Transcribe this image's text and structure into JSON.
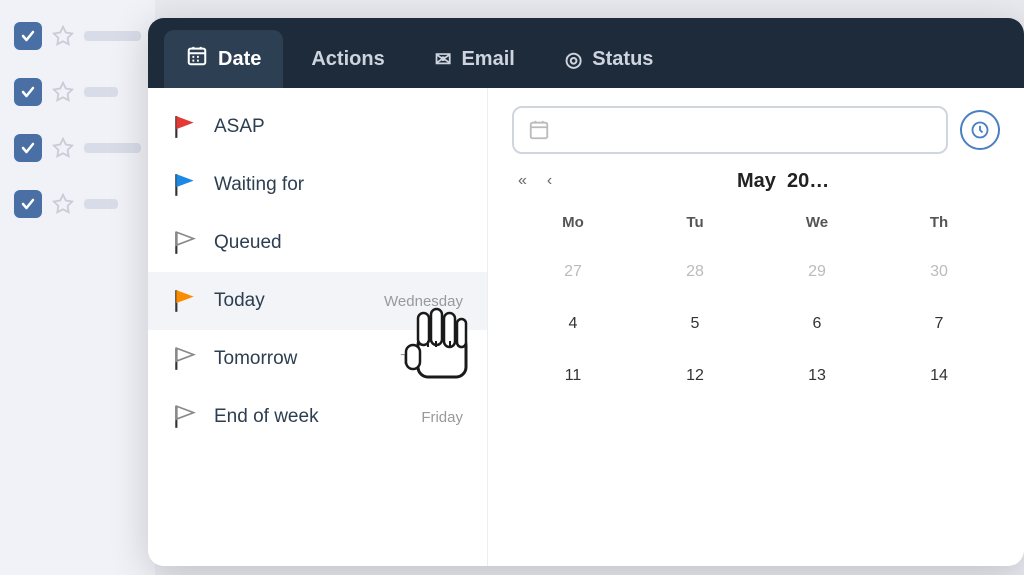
{
  "tabs": [
    {
      "id": "date",
      "label": "Date",
      "icon": "⊞",
      "active": true
    },
    {
      "id": "actions",
      "label": "Actions",
      "icon": "",
      "active": false
    },
    {
      "id": "email",
      "label": "Email",
      "icon": "✉",
      "active": false
    },
    {
      "id": "status",
      "label": "Status",
      "icon": "◎",
      "active": false
    }
  ],
  "menu_items": [
    {
      "id": "asap",
      "label": "ASAP",
      "day": "",
      "flag_color": "red"
    },
    {
      "id": "waiting_for",
      "label": "Waiting for",
      "day": "",
      "flag_color": "blue"
    },
    {
      "id": "queued",
      "label": "Queued",
      "day": "",
      "flag_color": "outline"
    },
    {
      "id": "today",
      "label": "Today",
      "day": "Wednesday",
      "flag_color": "orange",
      "highlighted": true
    },
    {
      "id": "tomorrow",
      "label": "Tomorrow",
      "day": "Thursday",
      "flag_color": "outline"
    },
    {
      "id": "end_of_week",
      "label": "End of week",
      "day": "Friday",
      "flag_color": "outline"
    }
  ],
  "calendar": {
    "month": "May",
    "year": "20",
    "header_days": [
      "Mo",
      "Tu",
      "We",
      "Th"
    ],
    "rows": [
      [
        "27",
        "28",
        "29",
        "30"
      ],
      [
        "4",
        "5",
        "6",
        "7"
      ],
      [
        "11",
        "12",
        "13",
        "14"
      ]
    ],
    "prev_month_days": [
      "27",
      "28",
      "29",
      "30"
    ],
    "date_input_placeholder": ""
  },
  "background_items": [
    {
      "checked": true
    },
    {
      "checked": true
    },
    {
      "checked": true
    },
    {
      "checked": true
    }
  ],
  "colors": {
    "tab_bar_bg": "#1e2b3a",
    "tab_active_bg": "#2d3f52",
    "accent_blue": "#4a7fc1",
    "flag_red": "#e53935",
    "flag_blue": "#1e88e5",
    "flag_orange": "#fb8c00"
  }
}
